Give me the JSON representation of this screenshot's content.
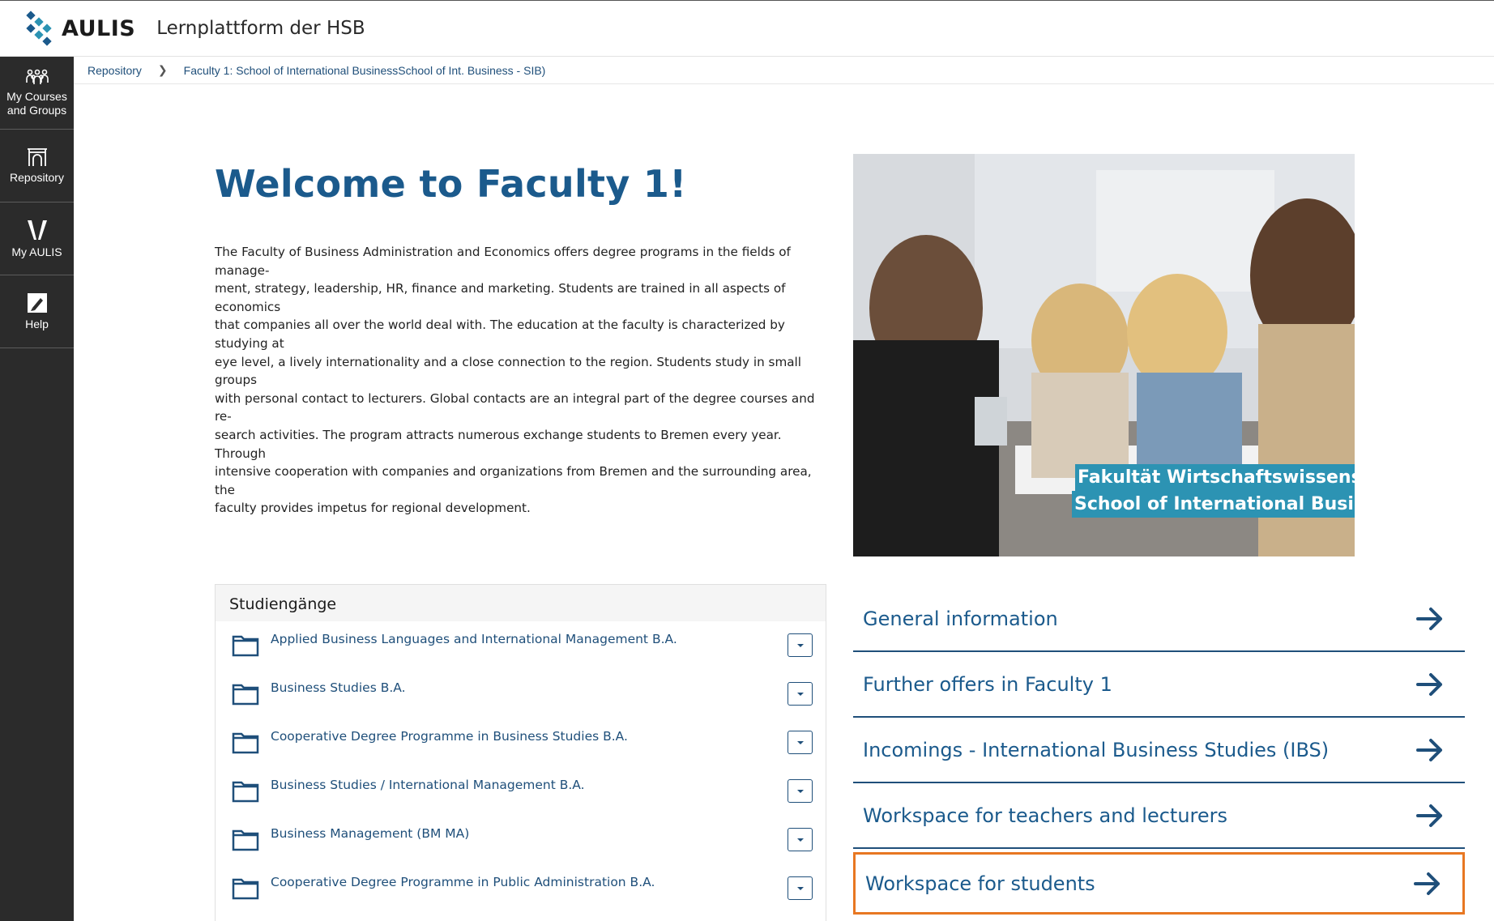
{
  "header": {
    "logo_text": "AULIS",
    "platform_title": "Lernplattform der HSB"
  },
  "sidebar": {
    "items": [
      {
        "label_line1": "My Courses",
        "label_line2": "and Groups",
        "icon": "people-icon"
      },
      {
        "label_line1": "Repository",
        "label_line2": "",
        "icon": "repository-icon"
      },
      {
        "label_line1": "My AULIS",
        "label_line2": "",
        "icon": "my-aulis-icon"
      },
      {
        "label_line1": "Help",
        "label_line2": "",
        "icon": "help-icon"
      }
    ]
  },
  "breadcrumb": {
    "items": [
      "Repository",
      "Faculty 1: School of International BusinessSchool of Int. Business - SIB)"
    ]
  },
  "main": {
    "title": "Welcome to Faculty 1!",
    "intro_lines": [
      "The Faculty of Business Administration and Economics offers degree programs in the fields of manage-",
      "ment, strategy, leadership, HR, finance and marketing. Students are trained in all aspects of economics",
      "that companies all over the world deal with. The education at the faculty is characterized by studying at",
      "eye level, a lively internationality and a close connection to the region. Students study in small groups",
      "with personal contact to lecturers. Global contacts are an integral part of the degree courses and re-",
      "search activities. The program attracts numerous exchange students to Bremen every year. Through",
      "intensive cooperation with companies and organizations from Bremen and the surrounding area, the",
      "faculty provides impetus for regional development."
    ],
    "hero_caption_line1": "Fakultät Wirtschaftswissenschaften",
    "hero_caption_line2": "School of International Business (SIB)"
  },
  "studiengaenge": {
    "heading": "Studiengänge",
    "items": [
      "Applied Business Languages and International Management B.A.",
      "Business Studies B.A.",
      "Cooperative Degree Programme in Business Studies B.A.",
      "Business Studies / International Management B.A.",
      "Business Management (BM MA)",
      "Cooperative Degree Programme in Public Administration B.A."
    ]
  },
  "links": [
    "General information",
    "Further offers in Faculty 1",
    "Incomings - International Business Studies (IBS)",
    "Workspace for teachers and lecturers",
    "Workspace for students"
  ],
  "colors": {
    "primary": "#1b5a8c",
    "link": "#1f4f7a",
    "sidebar": "#2b2b2b",
    "caption_bg": "#2c93b3",
    "highlight": "#e87722"
  }
}
